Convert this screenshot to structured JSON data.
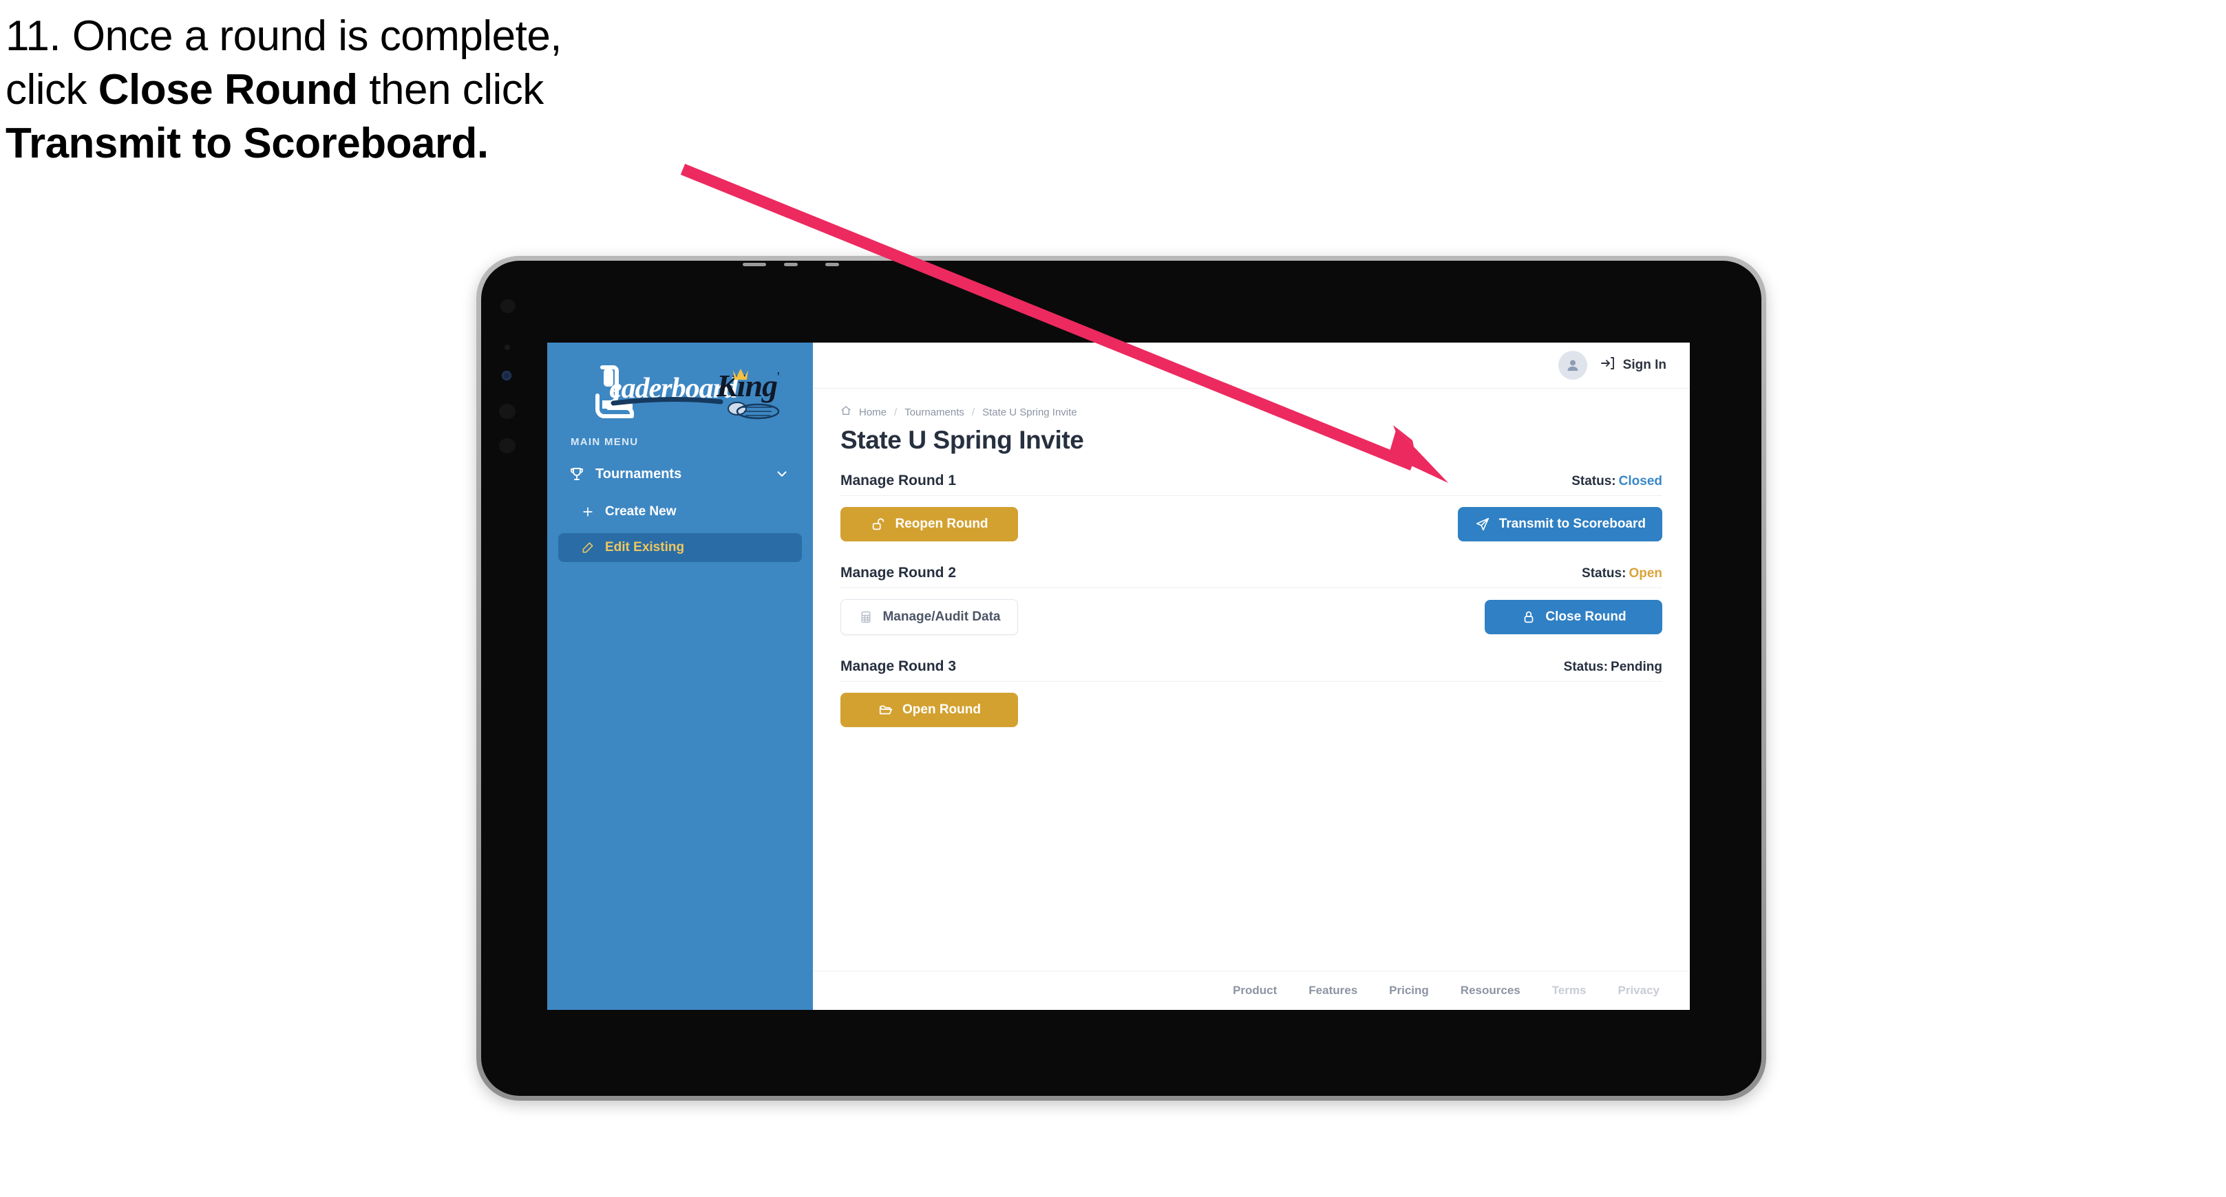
{
  "caption": {
    "line1_plain": "11. Once a round is complete,",
    "line2_pre": "click ",
    "line2_bold": "Close Round",
    "line2_post": " then click",
    "line3_bold": "Transmit to Scoreboard."
  },
  "annotation": {
    "arrow_color": "#ec2a5f",
    "arrow_points_to": "Transmit to Scoreboard"
  },
  "app": {
    "sidebar": {
      "logo_text_primary": "Leaderboard",
      "logo_text_secondary": "King",
      "section_label": "MAIN MENU",
      "items": [
        {
          "label": "Tournaments",
          "icon": "trophy-icon",
          "expanded": true
        },
        {
          "label": "Create New",
          "icon": "plus-icon",
          "active": false
        },
        {
          "label": "Edit Existing",
          "icon": "edit-pencil-icon",
          "active": true
        }
      ],
      "bg_color": "#3d87c3",
      "active_bg_color": "#2a6da6",
      "active_text_color": "#f0c761"
    },
    "topbar": {
      "sign_in_label": "Sign In",
      "avatar_icon": "user-avatar-icon",
      "sign_in_icon": "login-arrow-icon"
    },
    "breadcrumb": {
      "home_icon": "home-icon",
      "items": [
        "Home",
        "Tournaments",
        "State U Spring Invite"
      ],
      "separator": "/"
    },
    "page_title": "State U Spring Invite",
    "rounds": [
      {
        "title": "Manage Round 1",
        "status_label": "Status:",
        "status_value": "Closed",
        "status_color": "#3a87c8",
        "left_button": {
          "label": "Reopen Round",
          "icon": "unlock-icon",
          "style": "gold"
        },
        "right_button": {
          "label": "Transmit to Scoreboard",
          "icon": "paper-plane-icon",
          "style": "blue"
        }
      },
      {
        "title": "Manage Round 2",
        "status_label": "Status:",
        "status_value": "Open",
        "status_color": "#d9a43a",
        "left_button": {
          "label": "Manage/Audit Data",
          "icon": "table-grid-icon",
          "style": "ghost"
        },
        "right_button": {
          "label": "Close Round",
          "icon": "lock-icon",
          "style": "blue"
        }
      },
      {
        "title": "Manage Round 3",
        "status_label": "Status:",
        "status_value": "Pending",
        "status_color": "#27303f",
        "left_button": {
          "label": "Open Round",
          "icon": "open-folder-icon",
          "style": "gold"
        },
        "right_button": null
      }
    ],
    "footer": {
      "links": [
        {
          "label": "Product",
          "dim": false
        },
        {
          "label": "Features",
          "dim": false
        },
        {
          "label": "Pricing",
          "dim": false
        },
        {
          "label": "Resources",
          "dim": false
        },
        {
          "label": "Terms",
          "dim": true
        },
        {
          "label": "Privacy",
          "dim": true
        }
      ]
    }
  }
}
